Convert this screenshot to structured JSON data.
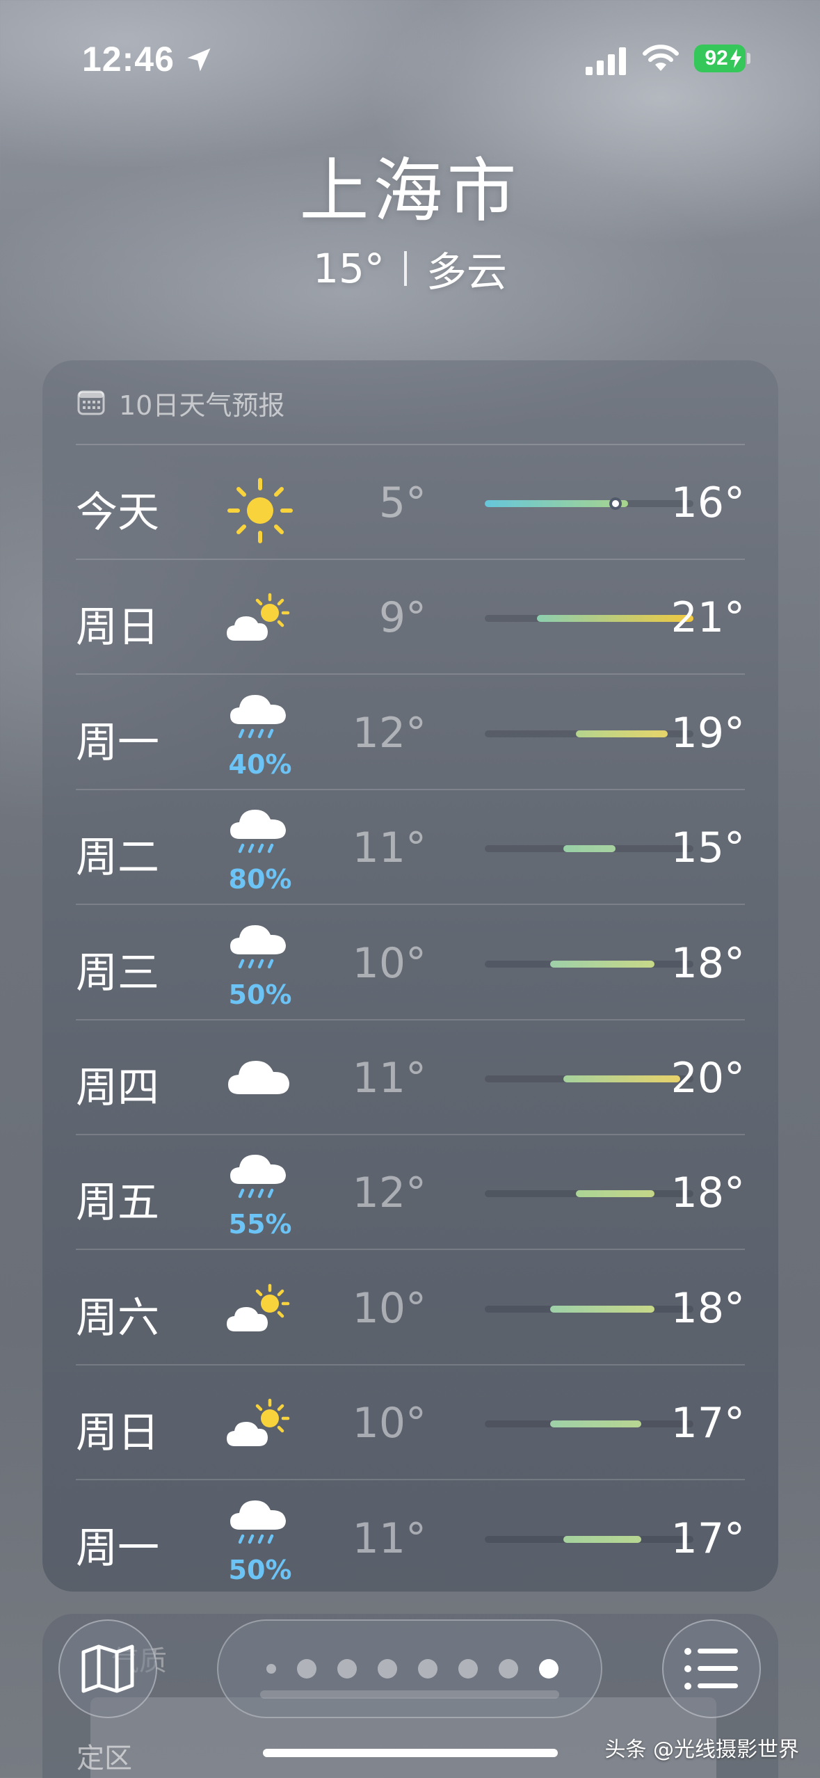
{
  "status_bar": {
    "time": "12:46",
    "battery": "92",
    "location_icon": "location-arrow-icon",
    "signal_icon": "cellular-signal-icon",
    "wifi_icon": "wifi-icon"
  },
  "header": {
    "city": "上海市",
    "temperature": "15°",
    "condition": "多云"
  },
  "forecast": {
    "title": "10日天气预报",
    "title_icon": "calendar-icon",
    "range_min": 5,
    "range_max": 21,
    "days": [
      {
        "day": "今天",
        "icon": "sun-icon",
        "prob": "",
        "low": "5°",
        "high": "16°",
        "low_val": 5,
        "high_val": 16,
        "current_val": 15,
        "colors": [
          "#66c6da",
          "#a8d48c"
        ]
      },
      {
        "day": "周日",
        "icon": "partly-sunny-icon",
        "prob": "",
        "low": "9°",
        "high": "21°",
        "low_val": 9,
        "high_val": 21,
        "colors": [
          "#8ccfb0",
          "#f2c83e"
        ]
      },
      {
        "day": "周一",
        "icon": "rain-icon",
        "prob": "40%",
        "low": "12°",
        "high": "19°",
        "low_val": 12,
        "high_val": 19,
        "colors": [
          "#b4d48e",
          "#e6d46a"
        ]
      },
      {
        "day": "周二",
        "icon": "rain-icon",
        "prob": "80%",
        "low": "11°",
        "high": "15°",
        "low_val": 11,
        "high_val": 15,
        "colors": [
          "#98d0a6",
          "#a8d2a0"
        ]
      },
      {
        "day": "周三",
        "icon": "rain-icon",
        "prob": "50%",
        "low": "10°",
        "high": "18°",
        "low_val": 10,
        "high_val": 18,
        "colors": [
          "#9ed0a8",
          "#c8d888"
        ]
      },
      {
        "day": "周四",
        "icon": "cloud-icon",
        "prob": "",
        "low": "11°",
        "high": "20°",
        "low_val": 11,
        "high_val": 20,
        "colors": [
          "#a6d29e",
          "#e8d26a"
        ]
      },
      {
        "day": "周五",
        "icon": "rain-icon",
        "prob": "55%",
        "low": "12°",
        "high": "18°",
        "low_val": 12,
        "high_val": 18,
        "colors": [
          "#acd496",
          "#c4d688"
        ]
      },
      {
        "day": "周六",
        "icon": "partly-sunny-icon",
        "prob": "",
        "low": "10°",
        "high": "18°",
        "low_val": 10,
        "high_val": 18,
        "colors": [
          "#9ed0a8",
          "#c8d888"
        ]
      },
      {
        "day": "周日",
        "icon": "partly-sunny-icon",
        "prob": "",
        "low": "10°",
        "high": "17°",
        "low_val": 10,
        "high_val": 17,
        "colors": [
          "#9ed0a8",
          "#b8d692"
        ]
      },
      {
        "day": "周一",
        "icon": "rain-icon",
        "prob": "50%",
        "low": "11°",
        "high": "17°",
        "low_val": 11,
        "high_val": 17,
        "colors": [
          "#a6d29e",
          "#b8d692"
        ]
      }
    ]
  },
  "air_quality": {
    "title": "气质",
    "subtitle": "定区"
  },
  "bottom_bar": {
    "map_icon": "map-icon",
    "list_icon": "list-icon",
    "page_count": 8,
    "active_page": 8
  },
  "watermark": "头条 @光线摄影世界"
}
